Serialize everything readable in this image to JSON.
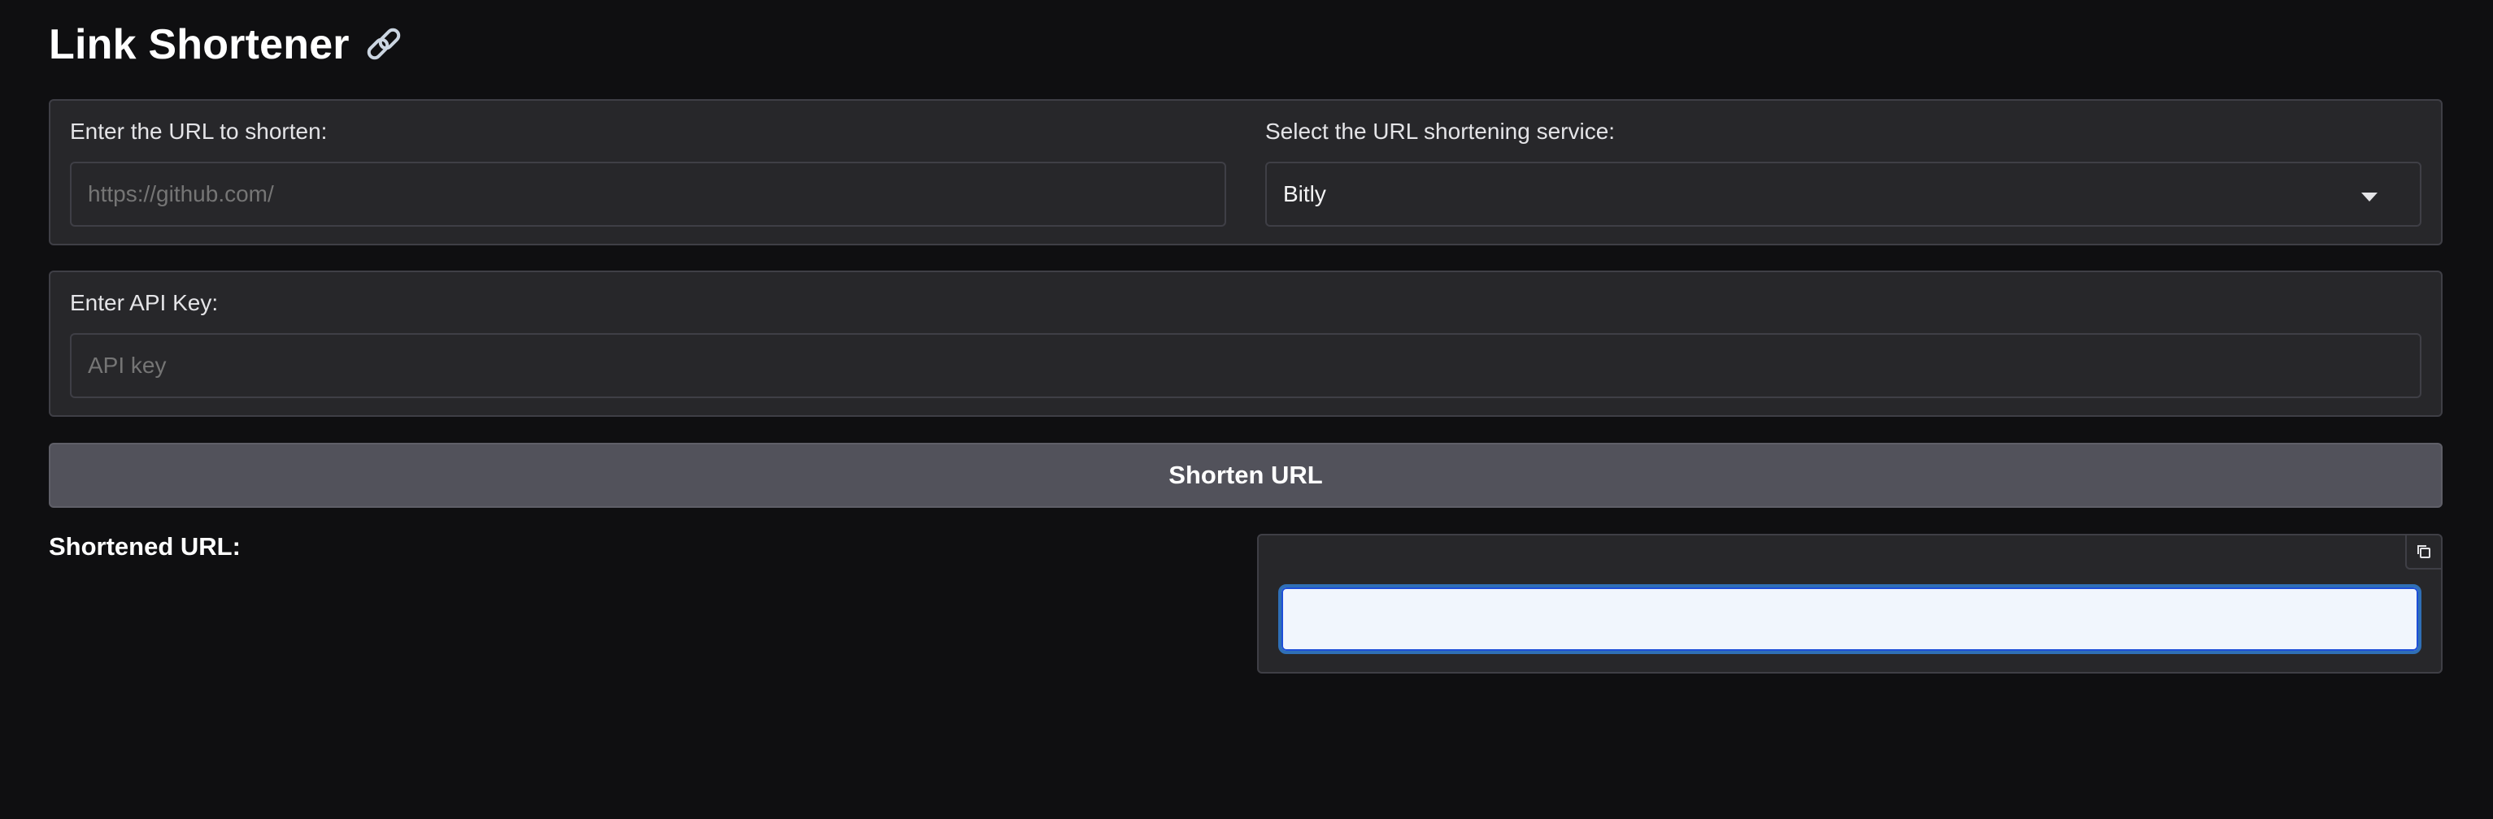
{
  "app": {
    "title": "Link Shortener",
    "title_icon": "link-icon"
  },
  "url_input": {
    "label": "Enter the URL to shorten:",
    "placeholder": "https://github.com/",
    "value": ""
  },
  "service_select": {
    "label": "Select the URL shortening service:",
    "selected": "Bitly",
    "icon": "chevron-down-icon"
  },
  "api_key": {
    "label": "Enter API Key:",
    "placeholder": "API key",
    "value": ""
  },
  "shorten_button": {
    "label": "Shorten URL"
  },
  "result": {
    "label": "Shortened URL:",
    "value": "",
    "copy_icon": "copy-icon"
  },
  "colors": {
    "background": "#0f0f11",
    "panel": "#27272a",
    "border": "#3f3f46",
    "button": "#52525b",
    "focus": "#2f6fb6",
    "result_fill": "#f1f6fd"
  }
}
